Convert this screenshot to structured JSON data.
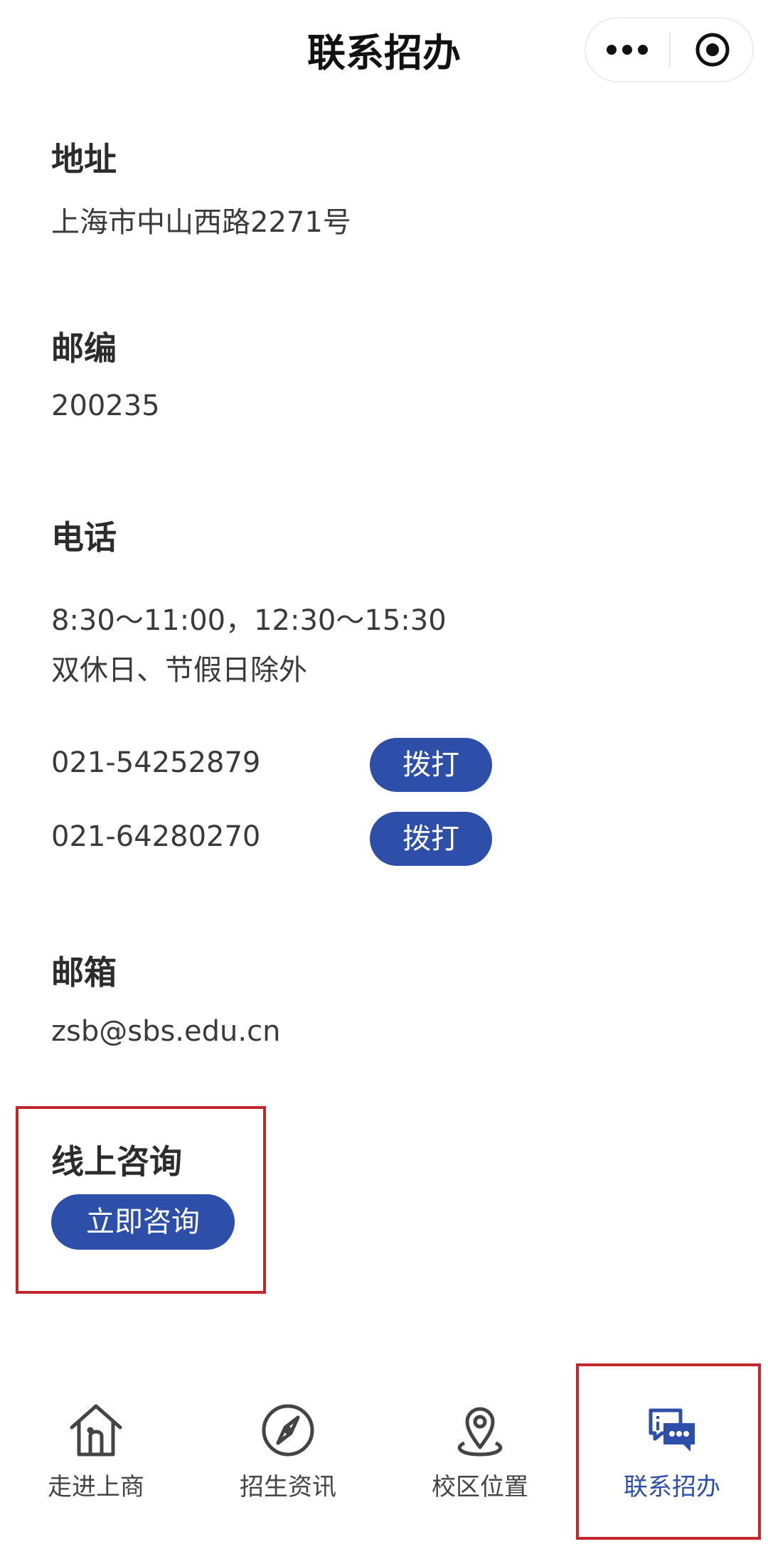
{
  "header": {
    "title": "联系招办"
  },
  "address": {
    "title": "地址",
    "value": "上海市中山西路2271号"
  },
  "postcode": {
    "title": "邮编",
    "value": "200235"
  },
  "phone": {
    "title": "电话",
    "hours_line1": "8:30～11:00，12:30～15:30",
    "hours_line2": "双休日、节假日除外",
    "numbers": [
      {
        "number": "021-54252879",
        "button_label": "拨打"
      },
      {
        "number": "021-64280270",
        "button_label": "拨打"
      }
    ]
  },
  "email": {
    "title": "邮箱",
    "value": "zsb@sbs.edu.cn"
  },
  "online": {
    "title": "线上咨询",
    "button_label": "立即咨询"
  },
  "tabbar": {
    "items": [
      {
        "label": "走进上商",
        "icon": "home-icon"
      },
      {
        "label": "招生资讯",
        "icon": "compass-icon"
      },
      {
        "label": "校区位置",
        "icon": "location-pin-icon"
      },
      {
        "label": "联系招办",
        "icon": "chat-info-icon"
      }
    ],
    "active_index": 3
  },
  "colors": {
    "accent": "#2e4fa9",
    "highlight_border": "#c1272d",
    "text": "#333333"
  }
}
